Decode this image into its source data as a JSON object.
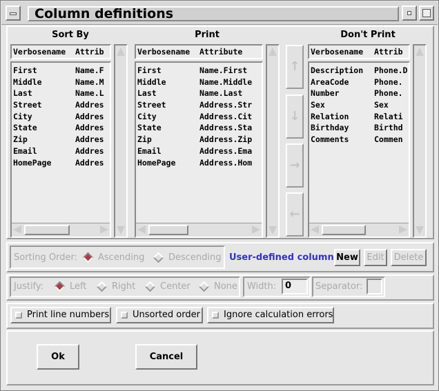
{
  "window": {
    "title": "Column definitions"
  },
  "columns": {
    "sort_by": {
      "label": "Sort By",
      "header": [
        "Verbosename",
        "Attrib"
      ],
      "rows": [
        [
          "First",
          "Name.F"
        ],
        [
          "Middle",
          "Name.M"
        ],
        [
          "Last",
          "Name.L"
        ],
        [
          "Street",
          "Addres"
        ],
        [
          "City",
          "Addres"
        ],
        [
          "State",
          "Addres"
        ],
        [
          "Zip",
          "Addres"
        ],
        [
          "Email",
          "Addres"
        ],
        [
          "HomePage",
          "Addres"
        ]
      ]
    },
    "print": {
      "label": "Print",
      "header": [
        "Verbosename",
        "Attribute"
      ],
      "rows": [
        [
          "First",
          "Name.First"
        ],
        [
          "Middle",
          "Name.Middle"
        ],
        [
          "Last",
          "Name.Last"
        ],
        [
          "Street",
          "Address.Str"
        ],
        [
          "City",
          "Address.Cit"
        ],
        [
          "State",
          "Address.Sta"
        ],
        [
          "Zip",
          "Address.Zip"
        ],
        [
          "Email",
          "Address.Ema"
        ],
        [
          "HomePage",
          "Address.Hom"
        ]
      ]
    },
    "dont_print": {
      "label": "Don't Print",
      "header": [
        "Verbosename",
        "Attrib"
      ],
      "rows": [
        [
          "Description",
          "Phone.D"
        ],
        [
          "AreaCode",
          "Phone."
        ],
        [
          "Number",
          "Phone."
        ],
        [
          "Sex",
          "Sex"
        ],
        [
          "Relation",
          "Relati"
        ],
        [
          "Birthday",
          "Birthd"
        ],
        [
          "Comments",
          "Commen"
        ]
      ]
    }
  },
  "move_buttons": {
    "up": "↑",
    "down": "↓",
    "right": "→",
    "left": "←"
  },
  "sorting": {
    "label": "Sorting Order:",
    "options": [
      "Ascending",
      "Descending"
    ],
    "selected": "Ascending"
  },
  "user_columns": {
    "label": "User-defined columns:",
    "new": "New",
    "edit": "Edit",
    "delete": "Delete"
  },
  "justify": {
    "label": "Justify:",
    "options": [
      "Left",
      "Right",
      "Center",
      "None"
    ],
    "selected": "Left"
  },
  "width": {
    "label": "Width:",
    "value": "0"
  },
  "separator": {
    "label": "Separator:",
    "value": ""
  },
  "checkboxes": {
    "print_line_numbers": "Print line numbers",
    "unsorted_order": "Unsorted order",
    "ignore_calc_errors": "Ignore calculation errors"
  },
  "footer": {
    "ok": "Ok",
    "cancel": "Cancel"
  },
  "colors": {
    "accent_blue": "#3232c8",
    "radio_selected": "#b03a48"
  }
}
